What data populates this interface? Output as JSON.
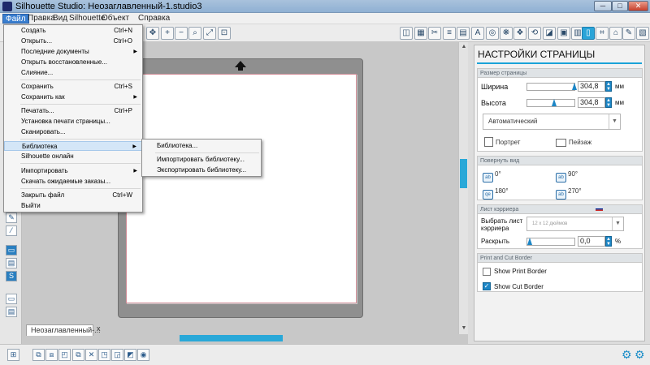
{
  "window": {
    "title": "Silhouette Studio: Неозаглавленный-1.studio3",
    "min_glyph": "─",
    "max_glyph": "□",
    "close_glyph": "✕"
  },
  "menubar": [
    "Файл",
    "Правка",
    "Вид",
    "Silhouette",
    "Объект",
    "Справка"
  ],
  "file_menu": {
    "items": [
      {
        "label": "Создать",
        "shortcut": "Ctrl+N"
      },
      {
        "label": "Открыть...",
        "shortcut": "Ctrl+O"
      },
      {
        "label": "Последние документы",
        "submenu": "▶"
      },
      {
        "label": "Открыть восстановленные..."
      },
      {
        "label": "Слияние..."
      },
      {
        "label": "Сохранить",
        "shortcut": "Ctrl+S"
      },
      {
        "label": "Сохранить как",
        "submenu": "▶"
      },
      {
        "label": "Печатать...",
        "shortcut": "Ctrl+P"
      },
      {
        "label": "Установка печати страницы..."
      },
      {
        "label": "Сканировать..."
      },
      {
        "label": "Библиотека",
        "submenu": "▶"
      },
      {
        "label": "Silhouette онлайн"
      },
      {
        "label": "Импортировать",
        "submenu": "▶"
      },
      {
        "label": "Скачать ожидаемые заказы..."
      },
      {
        "label": "Закрыть файл",
        "shortcut": "Ctrl+W"
      },
      {
        "label": "Выйти"
      }
    ]
  },
  "library_submenu": [
    "Библиотека...",
    "Импортировать библиотеку...",
    "Экспортировать библиотеку..."
  ],
  "document_tab": {
    "label": "Неозаглавленный-...",
    "close": "x"
  },
  "panel": {
    "title": "НАСТРОЙКИ СТРАНИЦЫ",
    "page_size": {
      "header": "Размер страницы",
      "width_label": "Ширина",
      "width_value": "304,8",
      "height_label": "Высота",
      "height_value": "304,8",
      "unit": "мм",
      "preset": "Автоматический",
      "portrait": "Портрет",
      "landscape": "Пейзаж"
    },
    "rotate": {
      "header": "Повернуть вид",
      "options": [
        "0°",
        "90°",
        "180°",
        "270°"
      ]
    },
    "carrier": {
      "header": "Лист кэрриера",
      "select_label_1": "Выбрать лист",
      "select_label_2": "кэрриера",
      "select_value": "12 x 12 дюймов",
      "reveal_label": "Раскрыть",
      "reveal_value": "0,0",
      "reveal_unit": "%"
    },
    "borders": {
      "header": "Print and Cut Border",
      "print_border": "Show Print Border",
      "cut_border": "Show Cut Border",
      "print_checked": false,
      "cut_checked": true
    }
  },
  "colors": {
    "accent": "#1aa3d8",
    "menu_highlight": "#3a7fd0"
  }
}
